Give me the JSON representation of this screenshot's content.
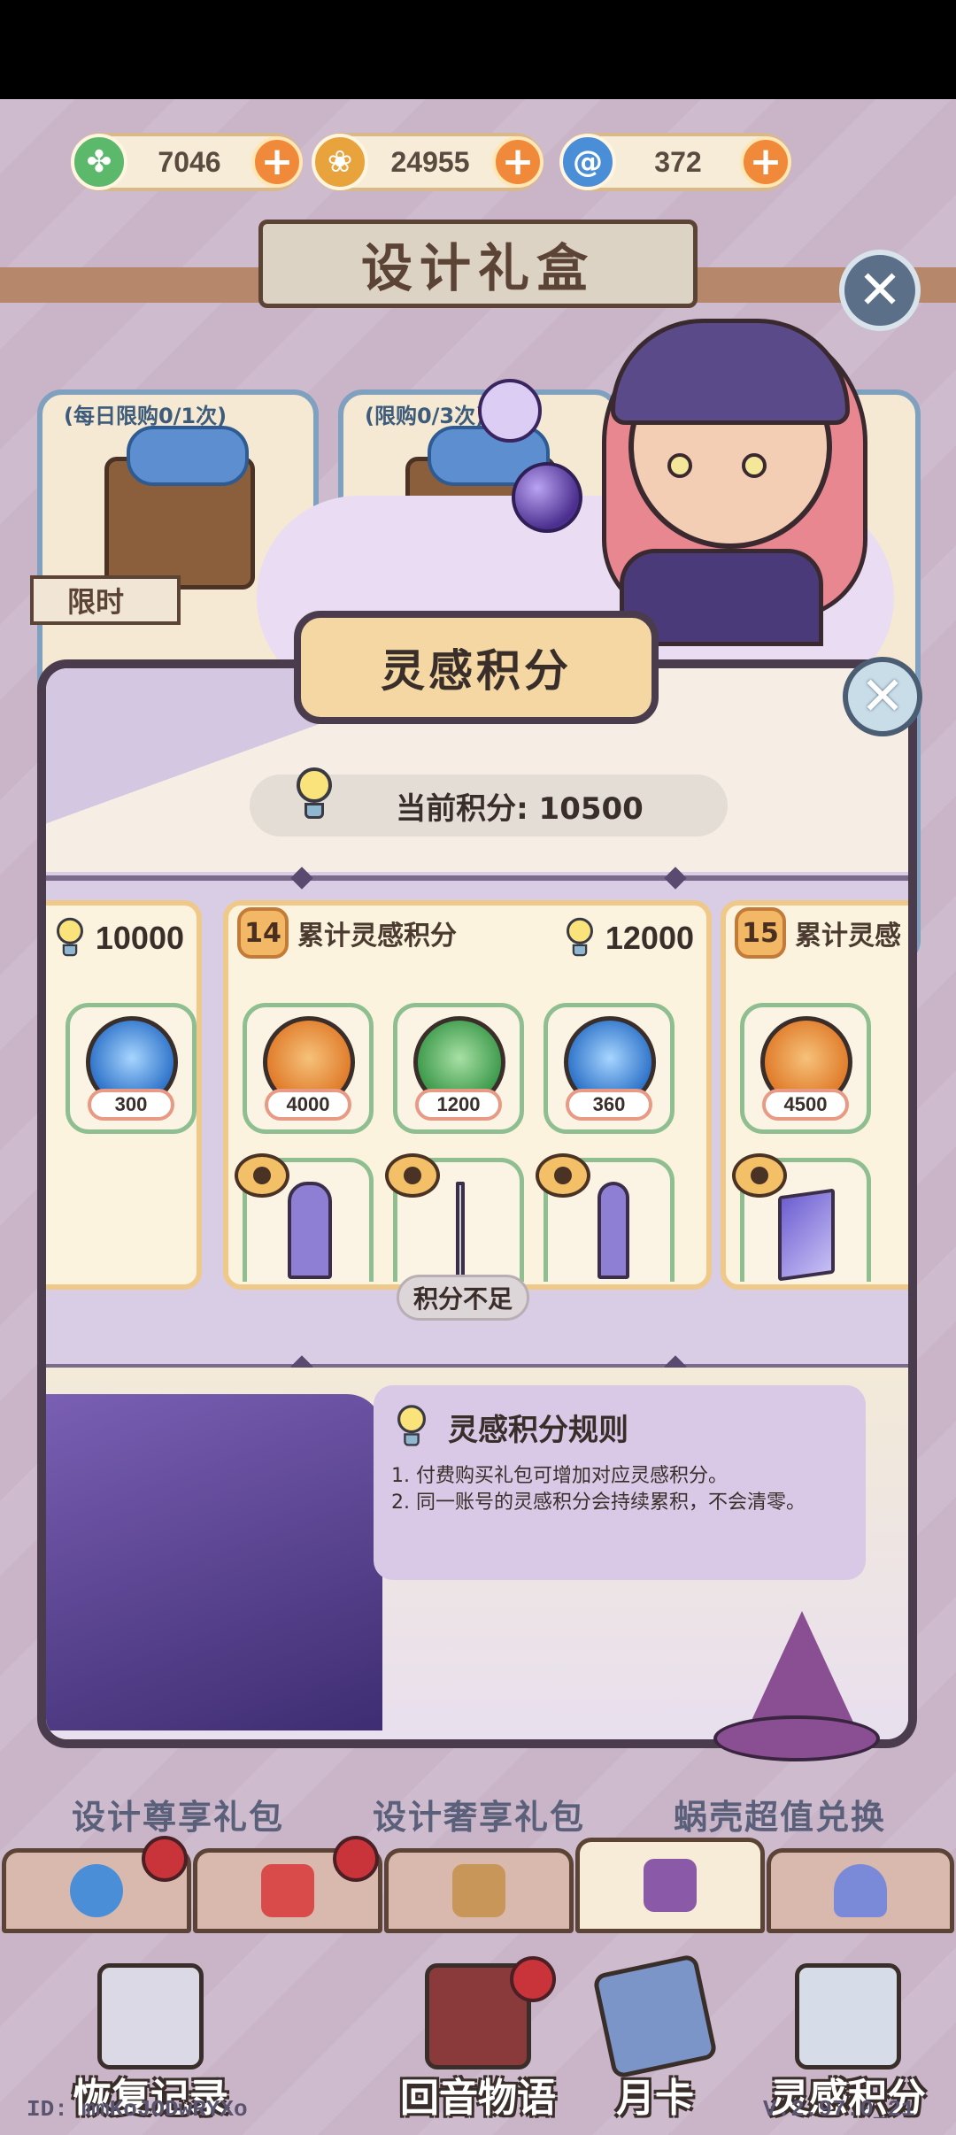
{
  "currencies": [
    {
      "name": "clover-coin",
      "value": "7046",
      "color": "#5cb86a"
    },
    {
      "name": "shell-coin",
      "value": "24955",
      "color": "#e8a33d"
    },
    {
      "name": "swirl-coin",
      "value": "372",
      "color": "#4a8ed8"
    }
  ],
  "shop": {
    "title": "设计礼盒",
    "card1_limit": "(每日限购0/1次)",
    "card2_limit": "(限购0/3次)",
    "limited_tag": "限时"
  },
  "modal": {
    "title": "灵感积分",
    "current_score_label": "当前积分: 10500",
    "insufficient": "积分不足",
    "prev_card": {
      "target": "10000",
      "amount": "300"
    },
    "card14": {
      "index": "14",
      "label": "累计灵感积分",
      "target": "12000",
      "rewards": [
        {
          "currency": "shell-coin",
          "amount": "4000"
        },
        {
          "currency": "clover-coin",
          "amount": "1200"
        },
        {
          "currency": "swirl-coin",
          "amount": "360"
        }
      ],
      "items": [
        "window-item",
        "sword-item",
        "mirror-item"
      ]
    },
    "card15": {
      "index": "15",
      "label": "累计灵感",
      "rewards": [
        {
          "currency": "shell-coin",
          "amount": "4500"
        }
      ],
      "items": [
        "panel-item"
      ]
    },
    "rules": {
      "title": "灵感积分规则",
      "line1": "1. 付费购买礼包可增加对应灵感积分。",
      "line2": "2. 同一账号的灵感积分会持续累积，不会清零。"
    }
  },
  "bg_packs": [
    "设计尊享礼包",
    "设计奢享礼包",
    "蜗壳超值兑换"
  ],
  "tabs": [
    "swirl-tab",
    "outfit-tab",
    "gift-tab",
    "scroll-tab",
    "friends-tab"
  ],
  "bottom_menu": [
    "恢复记录",
    "回音物语",
    "月卡",
    "灵感积分"
  ],
  "footer": {
    "id": "ID: mmKoJODwRYXo",
    "version": "V.2.97.0_21"
  }
}
